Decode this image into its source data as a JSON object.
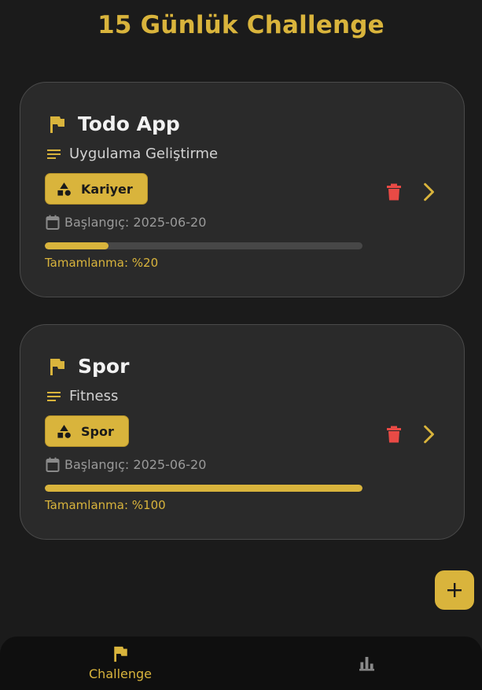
{
  "header": {
    "title": "15 Günlük Challenge"
  },
  "challenges": [
    {
      "title": "Todo App",
      "description": "Uygulama Geliştirme",
      "category": "Kariyer",
      "start_date": "Başlangıç: 2025-06-20",
      "progress": 0.2,
      "progress_label": "Tamamlanma: %20"
    },
    {
      "title": "Spor",
      "description": "Fitness",
      "category": "Spor",
      "start_date": "Başlangıç: 2025-06-20",
      "progress": 1.0,
      "progress_label": "Tamamlanma: %100"
    }
  ],
  "nav": {
    "items": [
      {
        "label": "Challenge",
        "icon": "flag-icon",
        "active": true
      },
      {
        "label": "",
        "icon": "bar-chart-icon",
        "active": false
      }
    ]
  },
  "colors": {
    "accent": "#d9b43c",
    "background": "#1b1b1b",
    "card": "#2a2a2a",
    "danger": "#e94a45"
  }
}
